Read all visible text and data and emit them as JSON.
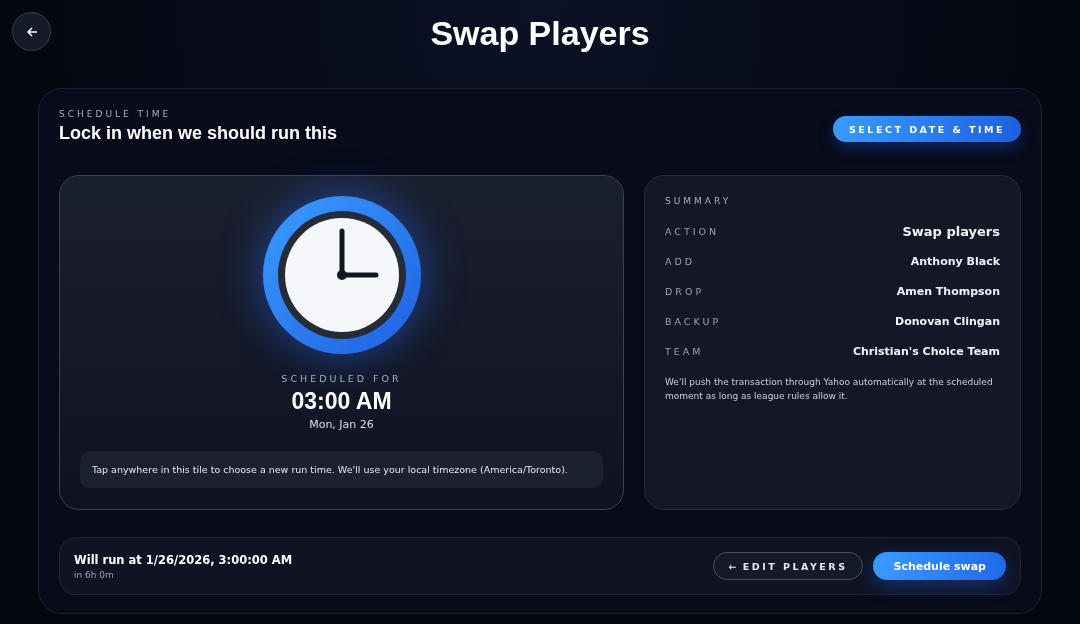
{
  "header": {
    "title": "Swap Players"
  },
  "section": {
    "eyebrow": "SCHEDULE TIME",
    "title": "Lock in when we should run this",
    "button": "SELECT DATE & TIME"
  },
  "schedule": {
    "label": "SCHEDULED FOR",
    "time": "03:00 AM",
    "date": "Mon, Jan 26",
    "hint": "Tap anywhere in this tile to choose a new run time. We'll use your local timezone (America/Toronto)."
  },
  "summary": {
    "title": "SUMMARY",
    "rows": [
      {
        "label": "ACTION",
        "value": "Swap players",
        "kind": "primary"
      },
      {
        "label": "ADD",
        "value": "Anthony Black",
        "kind": "plain"
      },
      {
        "label": "DROP",
        "value": "Amen Thompson",
        "kind": "plain"
      },
      {
        "label": "BACKUP",
        "value": "Donovan Clingan",
        "kind": "plain"
      },
      {
        "label": "TEAM",
        "value": "Christian's Choice Team",
        "kind": "plain"
      }
    ],
    "note": "We'll push the transaction through Yahoo automatically at the scheduled moment as long as league rules allow it."
  },
  "footer": {
    "run_at": "Will run at 1/26/2026, 3:00:00 AM",
    "countdown": "in 6h 0m",
    "edit_arrow": "←",
    "edit": "EDIT PLAYERS",
    "submit": "Schedule swap"
  }
}
